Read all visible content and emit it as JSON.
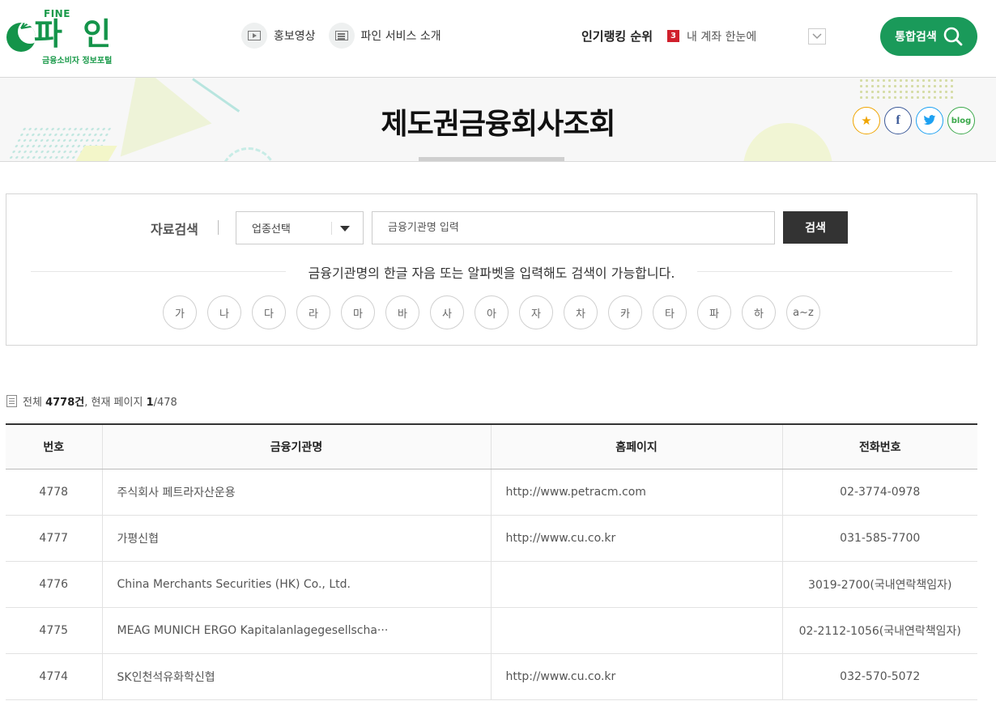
{
  "header": {
    "logo": {
      "fine": "FINE",
      "name": "파 인",
      "subtitle": "금융소비자 정보포털"
    },
    "nav": [
      {
        "label": "홍보영상",
        "icon": "video-icon"
      },
      {
        "label": "파인 서비스 소개",
        "icon": "document-icon"
      }
    ],
    "ranking": {
      "title": "인기랭킹 순위",
      "rank": "3",
      "text": "내 계좌 한눈에"
    },
    "search_button": "통합검색"
  },
  "banner": {
    "title": "제도권금융회사조회",
    "share": {
      "blog_label": "blog"
    }
  },
  "search": {
    "label": "자료검색",
    "category_select": "업종선택",
    "input_placeholder": "금융기관명 입력",
    "submit_label": "검색",
    "hint": "금융기관명의 한글 자음 또는 알파벳을 입력해도 검색이 가능합니다.",
    "initials": [
      "가",
      "나",
      "다",
      "라",
      "마",
      "바",
      "사",
      "아",
      "자",
      "차",
      "카",
      "타",
      "파",
      "하",
      "a~z"
    ]
  },
  "results": {
    "total_prefix": "전체 ",
    "total_count": "4778건",
    "page_prefix": ", 현재 페이지 ",
    "current_page": "1",
    "page_total": "/478",
    "columns": [
      "번호",
      "금융기관명",
      "홈페이지",
      "전화번호"
    ],
    "rows": [
      {
        "no": "4778",
        "name": "주식회사 페트라자산운용",
        "homepage": "http://www.petracm.com",
        "tel": "02-3774-0978"
      },
      {
        "no": "4777",
        "name": "가평신협",
        "homepage": "http://www.cu.co.kr",
        "tel": "031-585-7700"
      },
      {
        "no": "4776",
        "name": "China Merchants Securities (HK) Co., Ltd.",
        "homepage": "",
        "tel": "3019-2700(국내연락책임자)"
      },
      {
        "no": "4775",
        "name": "MEAG MUNICH ERGO Kapitalanlagegesellscha···",
        "homepage": "",
        "tel": "02-2112-1056(국내연락책임자)"
      },
      {
        "no": "4774",
        "name": "SK인천석유화학신협",
        "homepage": "http://www.cu.co.kr",
        "tel": "032-570-5072"
      }
    ]
  },
  "colors": {
    "brand_green": "#14944a",
    "search_green": "#1a9a5a",
    "rank_red": "#d0202c",
    "dark_button": "#333333"
  }
}
